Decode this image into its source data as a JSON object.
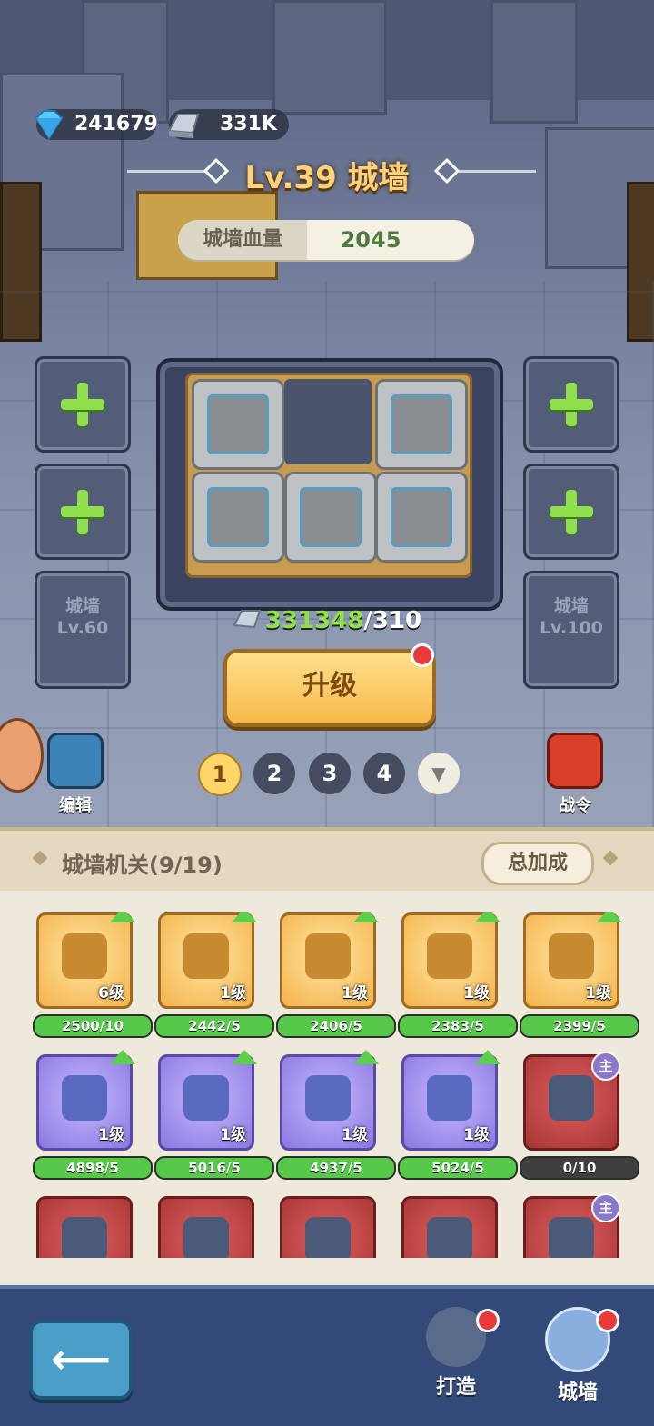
{
  "currency": {
    "diamonds": "241679",
    "iron": "331K"
  },
  "header": {
    "title": "Lv.39 城墙"
  },
  "wall_hp": {
    "label": "城墙血量",
    "value": "2045"
  },
  "locked_slots": {
    "left": {
      "name": "城墙",
      "level": "Lv.60"
    },
    "right": {
      "name": "城墙",
      "level": "Lv.100"
    }
  },
  "upgrade": {
    "have": "331348",
    "need": "/310",
    "button": "升级"
  },
  "pages": [
    "1",
    "2",
    "3",
    "4"
  ],
  "side_buttons": {
    "edit": "编辑",
    "battle_pass": "战令"
  },
  "panel": {
    "title": "城墙机关(9/19)",
    "bonus_button": "总加成",
    "items": [
      {
        "level": "6级",
        "progress": "2500/10",
        "fill": 1.0,
        "style": "gold",
        "upgradable": true
      },
      {
        "level": "1级",
        "progress": "2442/5",
        "fill": 1.0,
        "style": "gold",
        "upgradable": true
      },
      {
        "level": "1级",
        "progress": "2406/5",
        "fill": 1.0,
        "style": "gold",
        "upgradable": true
      },
      {
        "level": "1级",
        "progress": "2383/5",
        "fill": 1.0,
        "style": "gold",
        "upgradable": true
      },
      {
        "level": "1级",
        "progress": "2399/5",
        "fill": 1.0,
        "style": "gold",
        "upgradable": true
      },
      {
        "level": "1级",
        "progress": "4898/5",
        "fill": 1.0,
        "style": "purple",
        "upgradable": true
      },
      {
        "level": "1级",
        "progress": "5016/5",
        "fill": 1.0,
        "style": "purple",
        "upgradable": true
      },
      {
        "level": "1级",
        "progress": "4937/5",
        "fill": 1.0,
        "style": "purple",
        "upgradable": true
      },
      {
        "level": "1级",
        "progress": "5024/5",
        "fill": 1.0,
        "style": "purple",
        "upgradable": true
      },
      {
        "level": "",
        "progress": "0/10",
        "fill": 0.0,
        "style": "red",
        "badge": "主"
      },
      {
        "style": "red"
      },
      {
        "style": "red"
      },
      {
        "style": "red"
      },
      {
        "style": "red"
      },
      {
        "style": "red",
        "badge": "主"
      }
    ]
  },
  "nav": {
    "forge": "打造",
    "wall": "城墙"
  },
  "colors": {
    "accent_green": "#8fe04a",
    "title_gold": "#ffd27a",
    "red_dot": "#e83a3a"
  }
}
